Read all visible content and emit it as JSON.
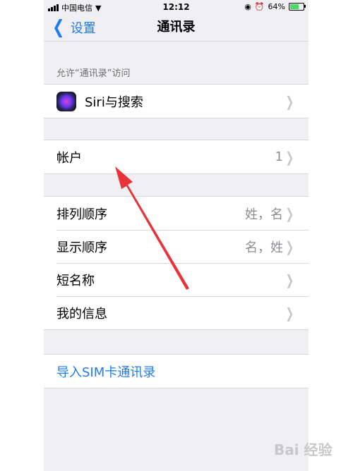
{
  "status_bar": {
    "carrier": "中国电信",
    "time": "12:12",
    "battery_percent": "64%",
    "battery_level": 0.64
  },
  "nav": {
    "back_label": "设置",
    "title": "通讯录"
  },
  "section_header": "允许“通讯录”访问",
  "siri_row": {
    "label": "Siri与搜索"
  },
  "accounts_row": {
    "label": "帐户",
    "value": "1"
  },
  "settings_rows": [
    {
      "label": "排列顺序",
      "value": "姓，名"
    },
    {
      "label": "显示顺序",
      "value": "名，姓"
    },
    {
      "label": "短名称",
      "value": ""
    },
    {
      "label": "我的信息",
      "value": ""
    }
  ],
  "import_row": {
    "label": "导入SIM卡通讯录"
  },
  "watermark": "Bai 经验",
  "colors": {
    "accent": "#1e7cf2",
    "background": "#efeff4",
    "annotation_arrow": "#e8333a"
  }
}
